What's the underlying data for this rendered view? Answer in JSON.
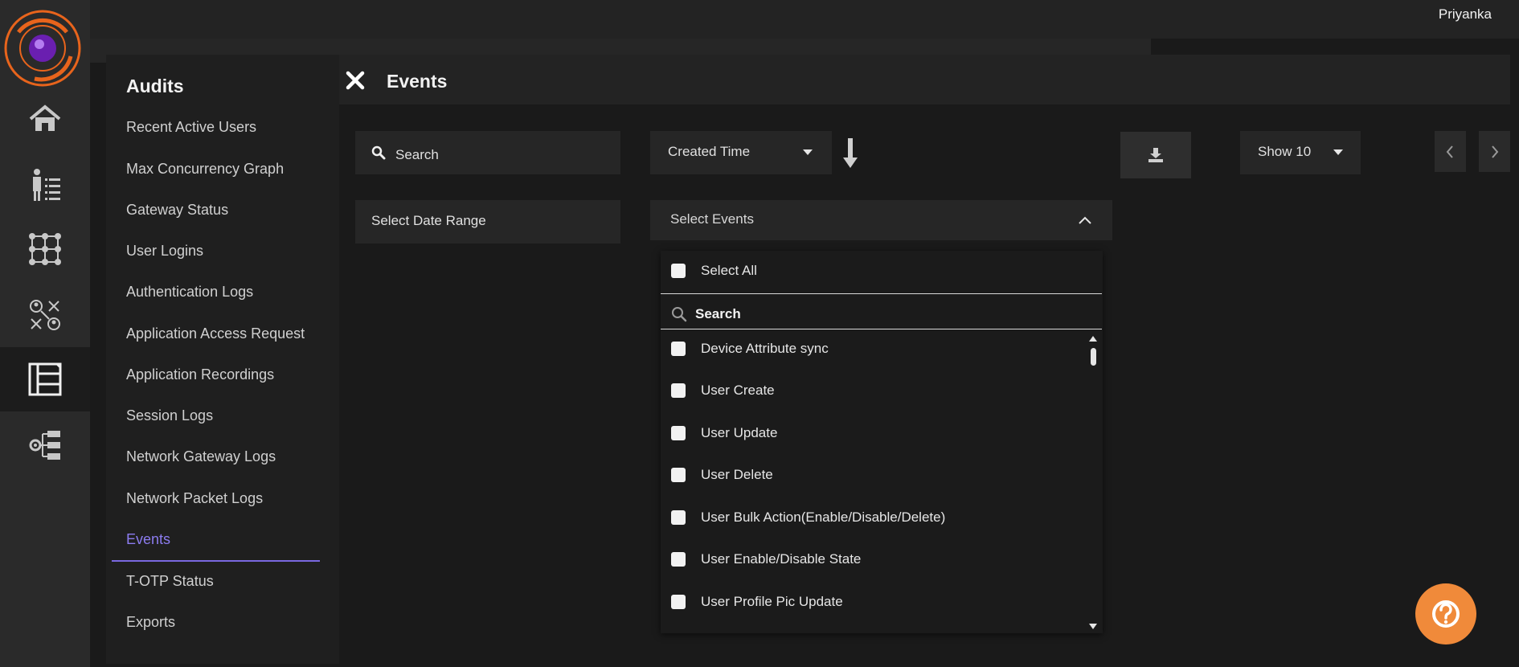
{
  "user": {
    "name": "Priyanka"
  },
  "rail": {
    "icons": [
      "home-icon",
      "user-list-icon",
      "grid-network-icon",
      "user-connections-icon",
      "audit-log-icon",
      "settings-hierarchy-icon"
    ],
    "active": "audit-log-icon"
  },
  "audits": {
    "title": "Audits",
    "items": [
      "Recent Active Users",
      "Max Concurrency Graph",
      "Gateway Status",
      "User Logins",
      "Authentication Logs",
      "Application Access Request",
      "Application Recordings",
      "Session Logs",
      "Network Gateway Logs",
      "Network Packet Logs",
      "Events",
      "T-OTP Status",
      "Exports"
    ],
    "active": "Events"
  },
  "page": {
    "title": "Events"
  },
  "toolbar": {
    "search_placeholder": "Search",
    "sort_by": "Created Time",
    "show": "Show 10",
    "date_range": "Select Date Range",
    "events_select": "Select Events"
  },
  "dropdown": {
    "select_all": "Select All",
    "search_placeholder": "Search",
    "options": [
      "Device Attribute sync",
      "User Create",
      "User Update",
      "User Delete",
      "User Bulk Action(Enable/Disable/Delete)",
      "User Enable/Disable State",
      "User Profile Pic Update"
    ]
  },
  "colors": {
    "accent": "#7a68e0",
    "help": "#f08a3a",
    "logo_orange": "#e8641c",
    "logo_purple": "#6a1fb0"
  }
}
